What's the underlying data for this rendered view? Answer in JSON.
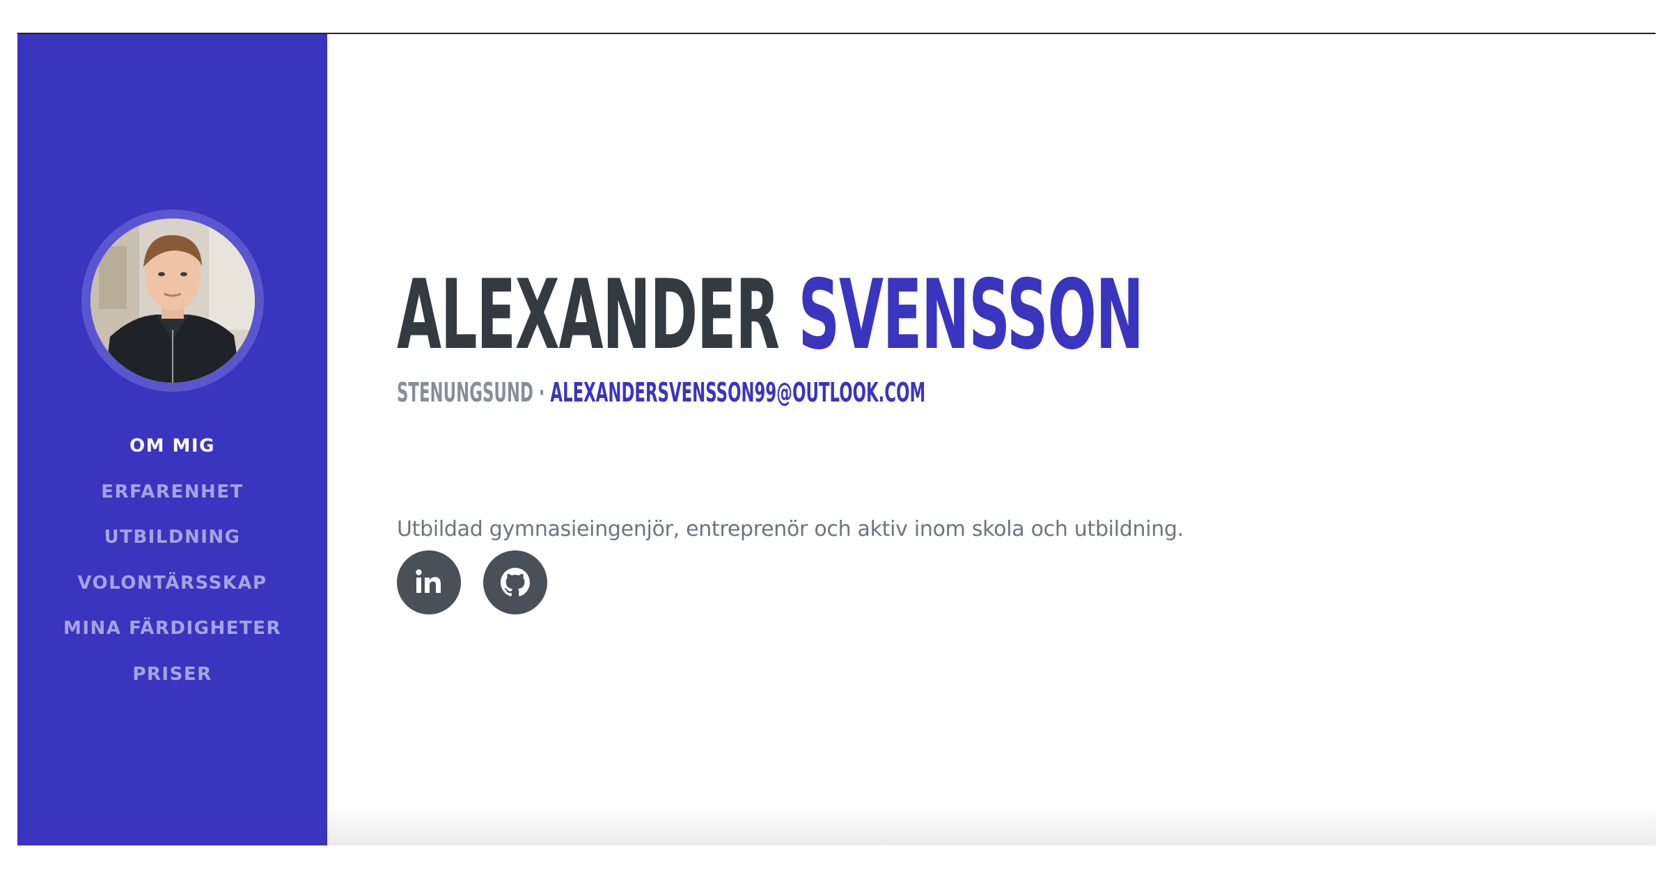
{
  "profile": {
    "first_name": "ALEXANDER",
    "last_name": "SVENSSON",
    "location": "STENUNGSUND",
    "separator": " · ",
    "email": "ALEXANDERSVENSSON99@OUTLOOK.COM",
    "lead": "Utbildad gymnasieingenjör, entreprenör och aktiv inom skola och utbildning."
  },
  "sidebar": {
    "items": [
      {
        "label": "OM MIG",
        "active": true
      },
      {
        "label": "ERFARENHET"
      },
      {
        "label": "UTBILDNING"
      },
      {
        "label": "VOLONTÄRSSKAP"
      },
      {
        "label": "MINA FÄRDIGHETER"
      },
      {
        "label": "PRISER"
      }
    ]
  },
  "social": [
    {
      "icon": "linkedin-icon"
    },
    {
      "icon": "github-icon"
    }
  ],
  "colors": {
    "primary": "#3935bf",
    "heading": "#333a40",
    "muted": "#868e96",
    "social_bg": "#495057"
  }
}
